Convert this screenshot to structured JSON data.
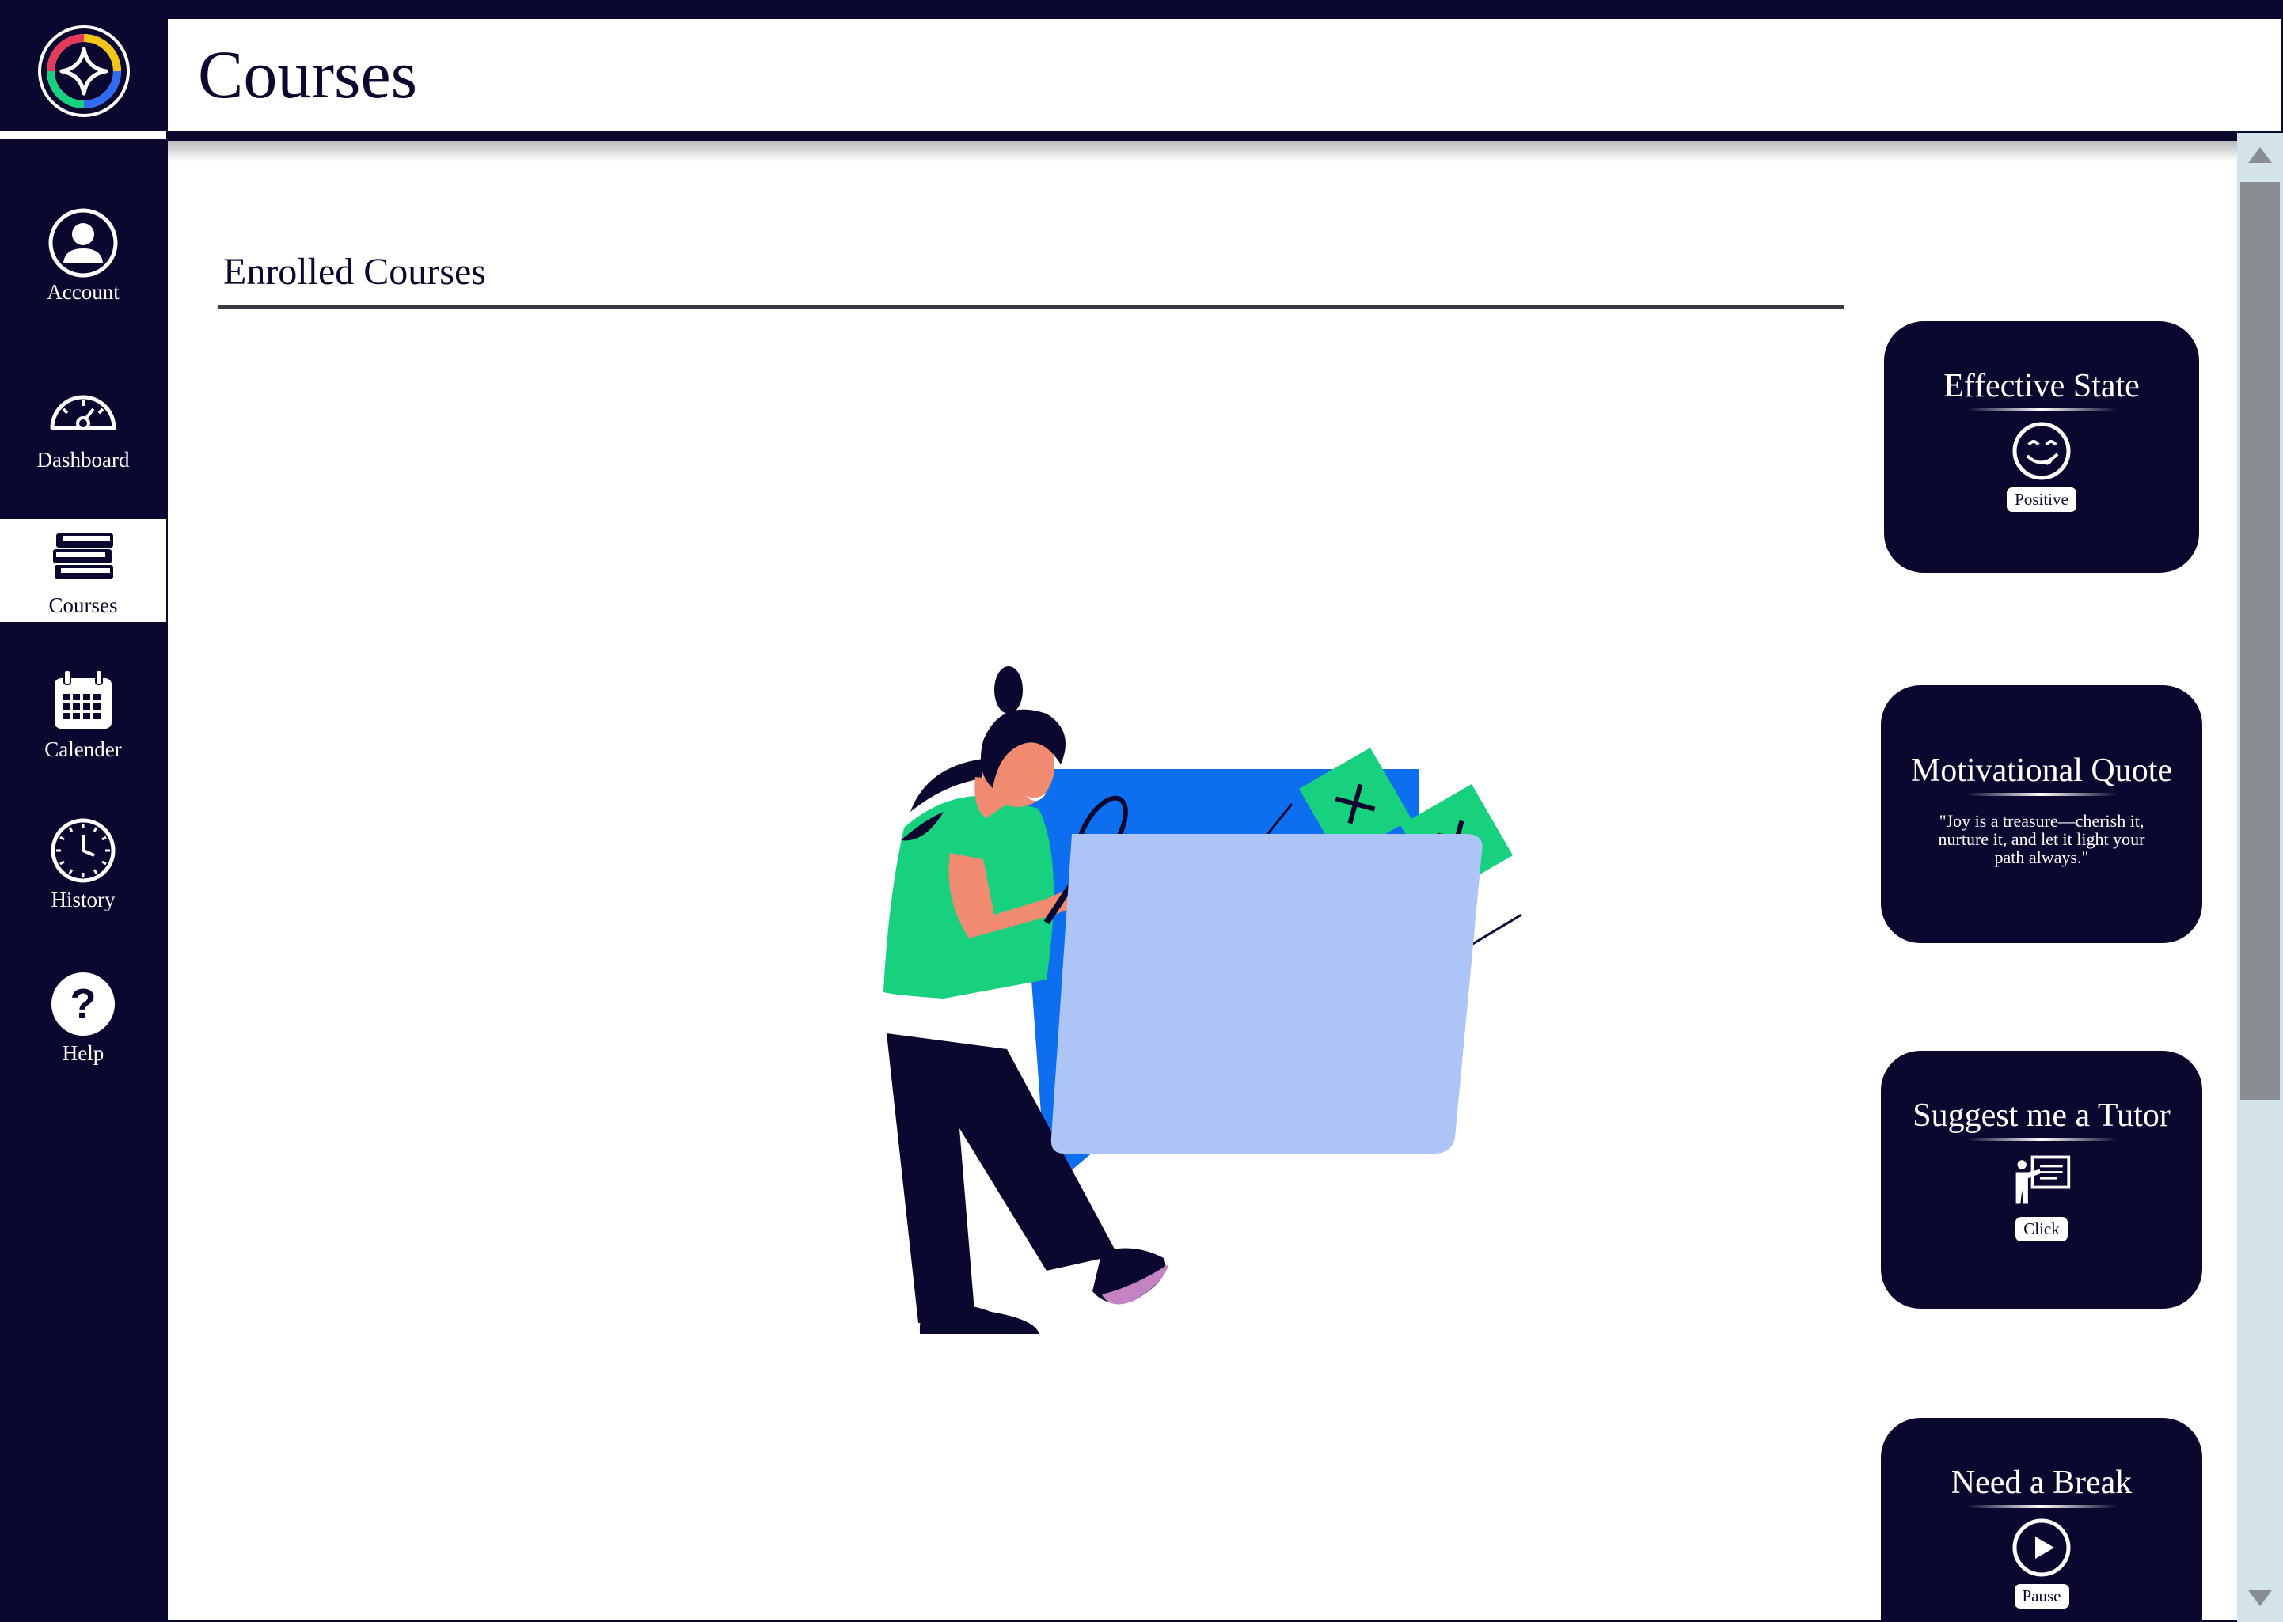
{
  "app": {
    "logo_icon": "sparkle-star-logo"
  },
  "header": {
    "title": "Courses"
  },
  "sidebar": {
    "items": [
      {
        "label": "Account",
        "icon": "user-icon"
      },
      {
        "label": "Dashboard",
        "icon": "gauge-icon"
      },
      {
        "label": "Courses",
        "icon": "books-icon",
        "active": true
      },
      {
        "label": "Calender",
        "icon": "calendar-icon"
      },
      {
        "label": "History",
        "icon": "clock-icon"
      },
      {
        "label": "Help",
        "icon": "question-icon"
      }
    ]
  },
  "main": {
    "section_title": "Enrolled Courses",
    "illustration": "woman-searching-folder-illustration"
  },
  "cards": {
    "effective_state": {
      "title": "Effective State",
      "icon": "smiley-face-icon",
      "button": "Positive"
    },
    "motivational_quote": {
      "title": "Motivational Quote",
      "quote": "\"Joy is a treasure—cherish it, nurture it, and let it light your path always.\""
    },
    "tutor": {
      "title": "Suggest me a Tutor",
      "icon": "teacher-board-icon",
      "button": "Click"
    },
    "break": {
      "title": "Need a Break",
      "icon": "play-icon",
      "button": "Pause"
    }
  },
  "colors": {
    "navy": "#0b0830",
    "green": "#17d17f",
    "blue": "#0d6ef0",
    "light_blue": "#adc5f6",
    "skin": "#f08a70",
    "pink": "#c484c4"
  }
}
